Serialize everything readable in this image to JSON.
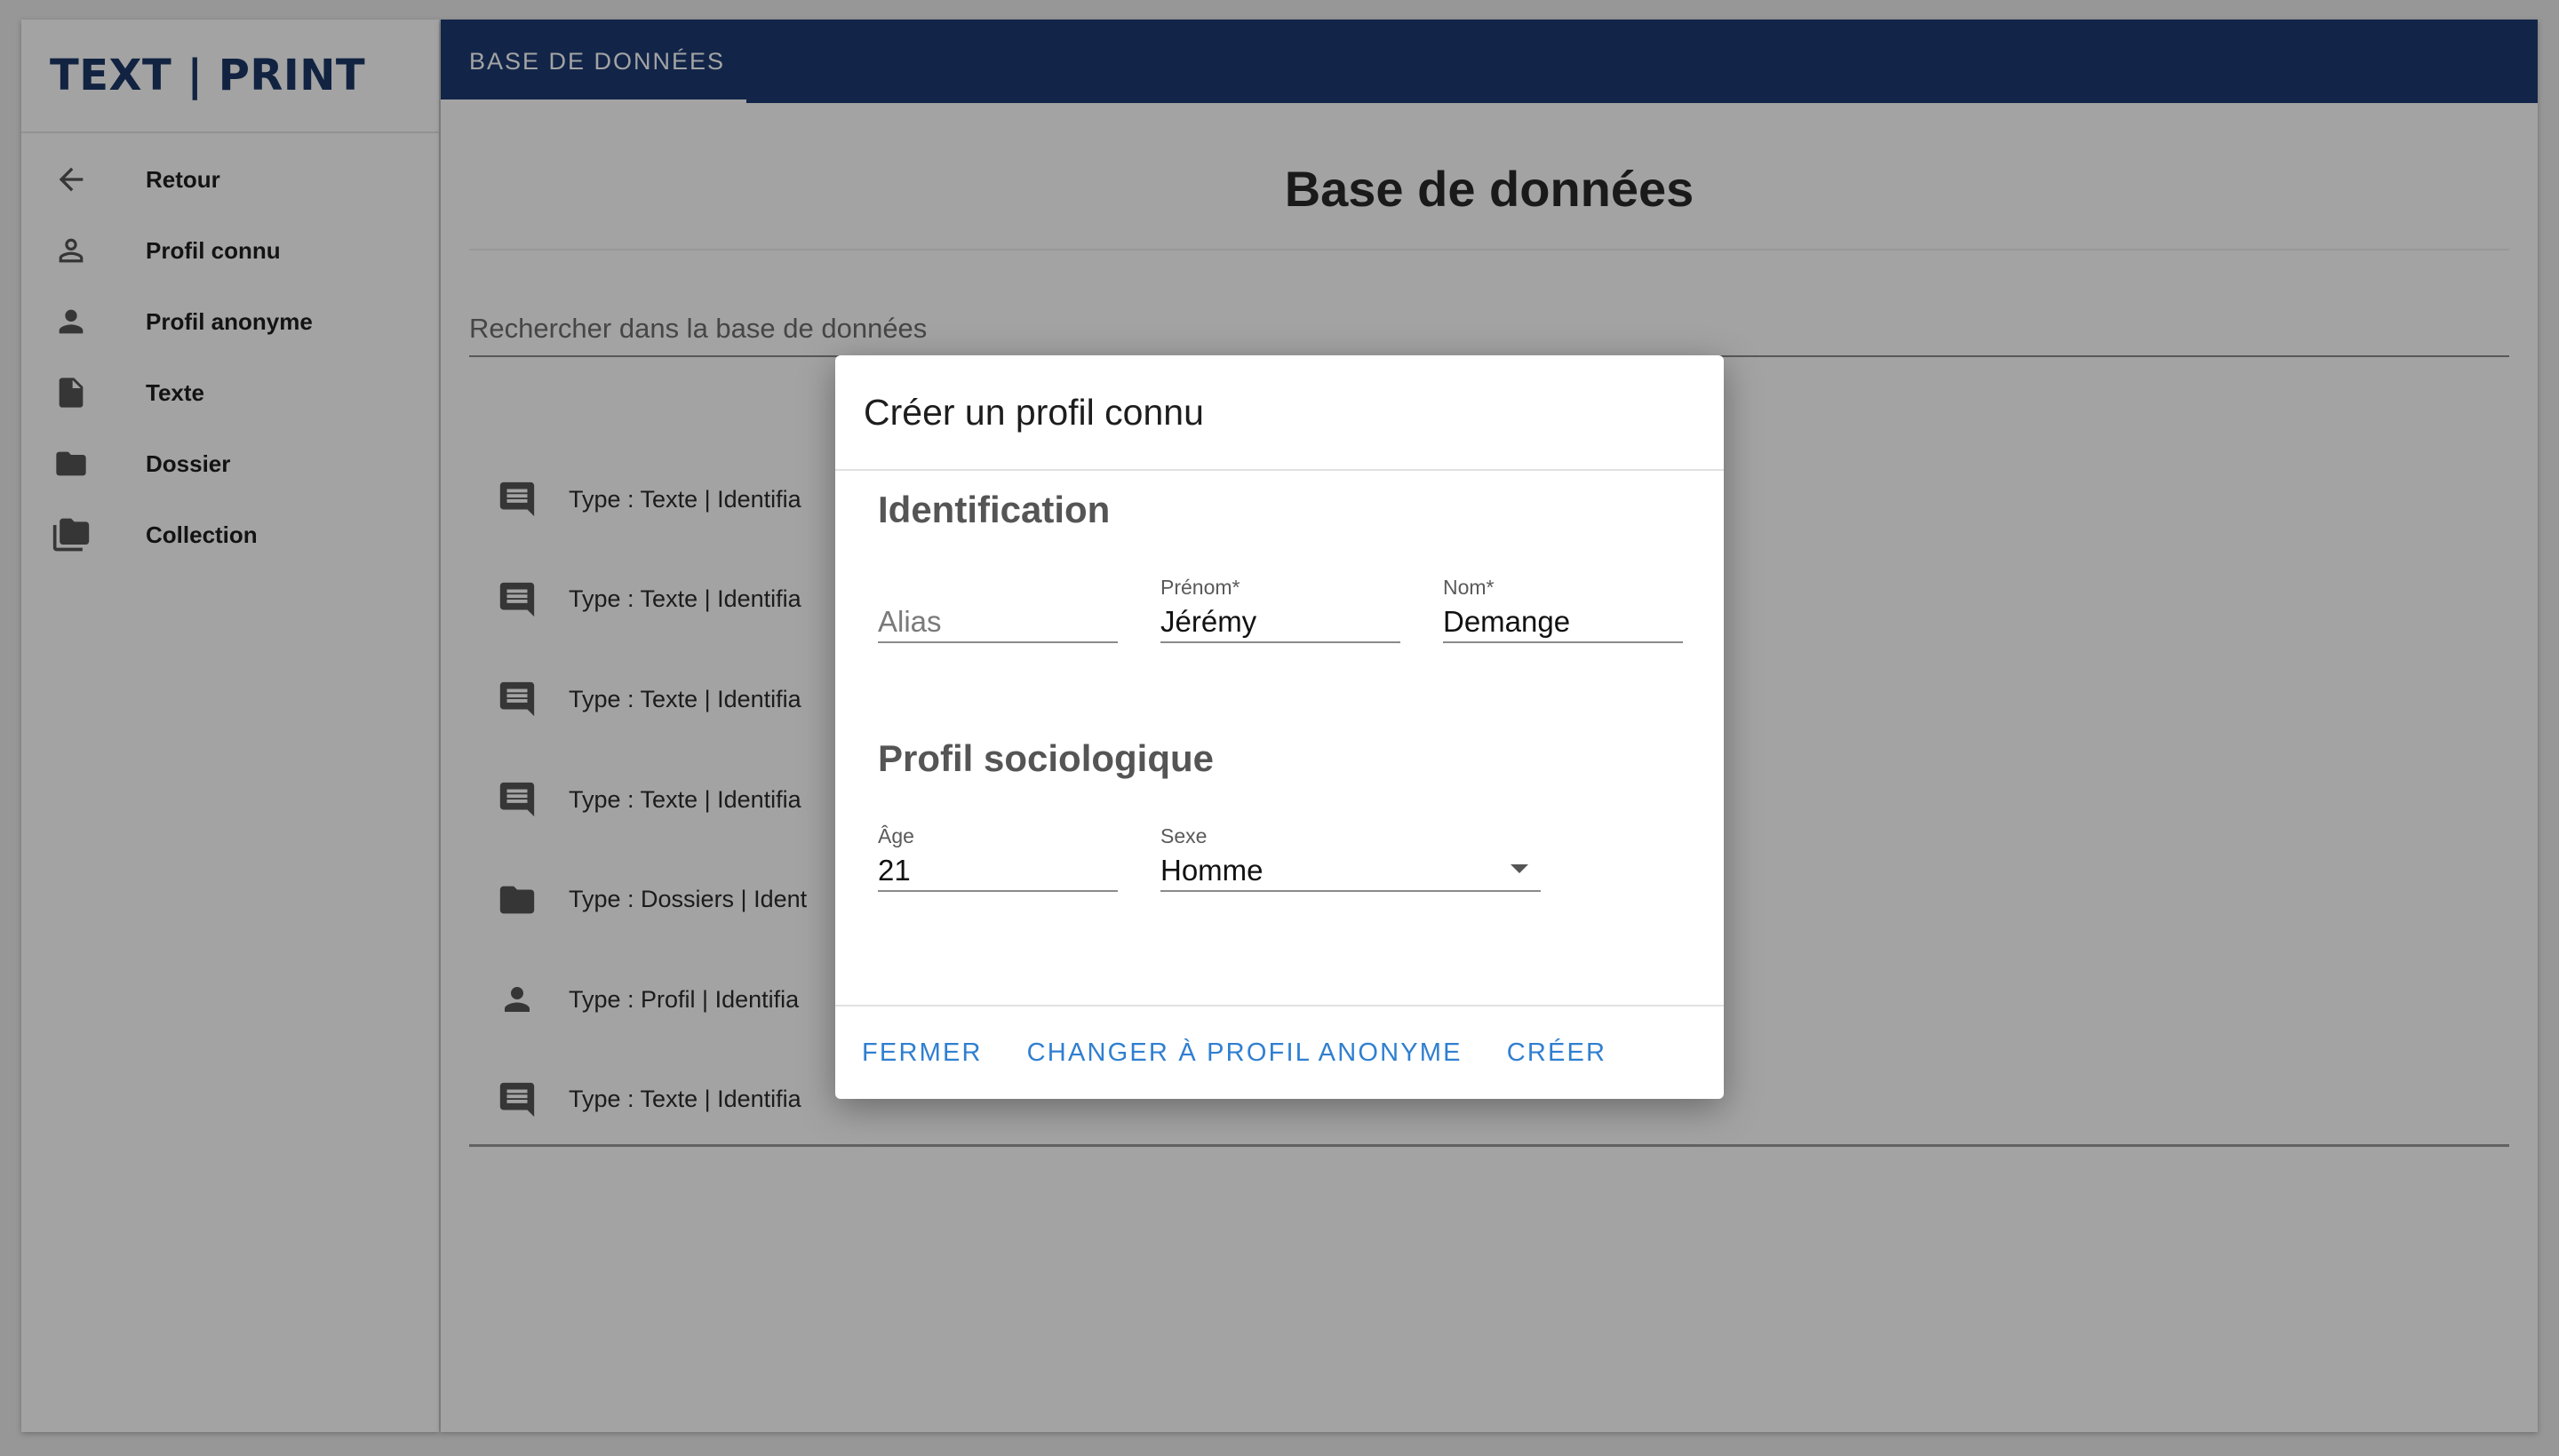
{
  "app": {
    "logo": "TEXT | PRINT"
  },
  "colors": {
    "brand": "#1d3b72",
    "accent": "#2f7fd0",
    "overlay": "rgba(0,0,0,0.36)"
  },
  "sidebar": {
    "items": [
      {
        "label": "Retour",
        "icon": "arrow-left-icon"
      },
      {
        "label": "Profil connu",
        "icon": "person-outline-icon"
      },
      {
        "label": "Profil anonyme",
        "icon": "person-icon"
      },
      {
        "label": "Texte",
        "icon": "document-icon"
      },
      {
        "label": "Dossier",
        "icon": "folder-icon"
      },
      {
        "label": "Collection",
        "icon": "folder-multiple-icon"
      }
    ]
  },
  "header": {
    "tab": "BASE DE DONNÉES"
  },
  "main": {
    "title": "Base de données",
    "search_placeholder": "Rechercher dans la base de données",
    "rows": [
      {
        "text": "Type : Texte | Identifia",
        "icon": "comment-icon"
      },
      {
        "text": "Type : Texte | Identifia",
        "icon": "comment-icon"
      },
      {
        "text": "Type : Texte | Identifia",
        "icon": "comment-icon"
      },
      {
        "text": "Type : Texte | Identifia",
        "icon": "comment-icon"
      },
      {
        "text": "Type : Dossiers | Ident",
        "icon": "folder-icon"
      },
      {
        "text": "Type : Profil | Identifia",
        "icon": "person-icon"
      },
      {
        "text": "Type : Texte | Identifia",
        "icon": "comment-icon"
      }
    ]
  },
  "dialog": {
    "title": "Créer un profil connu",
    "section_identification": "Identification",
    "alias_placeholder": "Alias",
    "prenom_label": "Prénom*",
    "prenom_value": "Jérémy",
    "nom_label": "Nom*",
    "nom_value": "Demange",
    "section_socio": "Profil sociologique",
    "age_label": "Âge",
    "age_value": "21",
    "sexe_label": "Sexe",
    "sexe_value": "Homme",
    "buttons": {
      "close": "FERMER",
      "switch": "CHANGER À PROFIL ANONYME",
      "create": "CRÉER"
    }
  }
}
